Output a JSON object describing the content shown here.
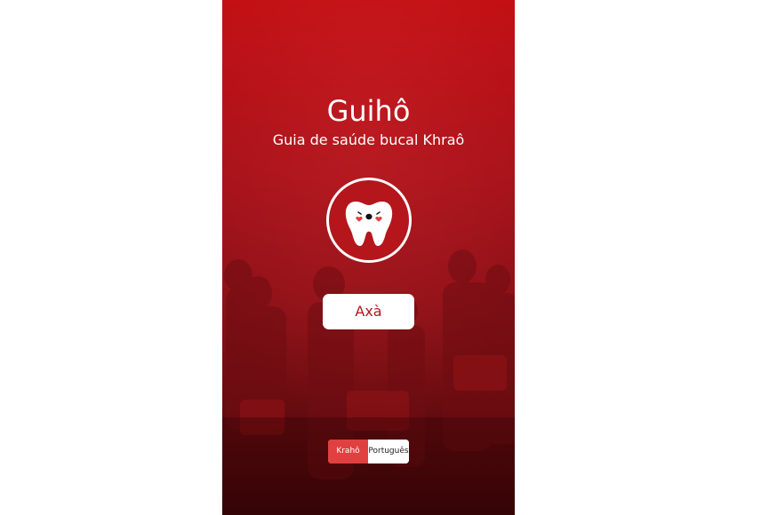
{
  "app": {
    "title": "Guihô",
    "subtitle": "Guia de saúde bucal Khraô"
  },
  "logo": {
    "icon": "tooth-icon"
  },
  "start_button": {
    "label": "Axà"
  },
  "language": {
    "options": [
      "Krahô",
      "Português"
    ],
    "selected": "Krahô"
  },
  "colors": {
    "primary": "#b4161c",
    "accent": "#e0403f"
  }
}
